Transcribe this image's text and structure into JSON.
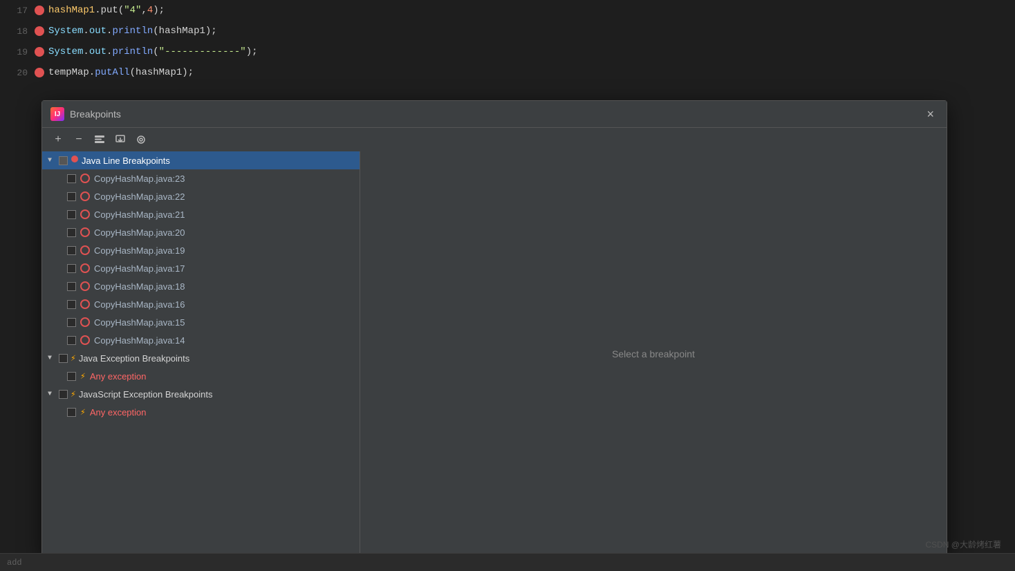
{
  "editor": {
    "lines": [
      {
        "num": 17,
        "hasBreakpoint": true,
        "code": "hashMap1.put(\"4\",4);"
      },
      {
        "num": 18,
        "hasBreakpoint": true,
        "code": "System.out.println(hashMap1);"
      },
      {
        "num": 19,
        "hasBreakpoint": true,
        "code": "System.out.println(\"----------\");"
      },
      {
        "num": 20,
        "hasBreakpoint": true,
        "code": "tempMap.putAll(hashMap1);"
      }
    ]
  },
  "dialog": {
    "title": "Breakpoints",
    "close_label": "×",
    "toolbar": {
      "add_label": "+",
      "remove_label": "−",
      "group_label": "⧉",
      "export_label": "⧉",
      "filter_label": "◎"
    },
    "select_text": "Select a breakpoint",
    "tree": {
      "java_line": {
        "label": "Java Line Breakpoints",
        "selected": true,
        "items": [
          {
            "label": "CopyHashMap.java:23"
          },
          {
            "label": "CopyHashMap.java:22"
          },
          {
            "label": "CopyHashMap.java:21"
          },
          {
            "label": "CopyHashMap.java:20"
          },
          {
            "label": "CopyHashMap.java:19"
          },
          {
            "label": "CopyHashMap.java:17"
          },
          {
            "label": "CopyHashMap.java:18"
          },
          {
            "label": "CopyHashMap.java:16"
          },
          {
            "label": "CopyHashMap.java:15"
          },
          {
            "label": "CopyHashMap.java:14"
          }
        ]
      },
      "java_exception": {
        "label": "Java Exception Breakpoints",
        "any_exception": "Any exception"
      },
      "js_exception": {
        "label": "JavaScript Exception Breakpoints",
        "any_exception": "Any exception"
      }
    }
  },
  "status": {
    "left_text": "add",
    "watermark": "CSDN @大龄烤红薯"
  }
}
